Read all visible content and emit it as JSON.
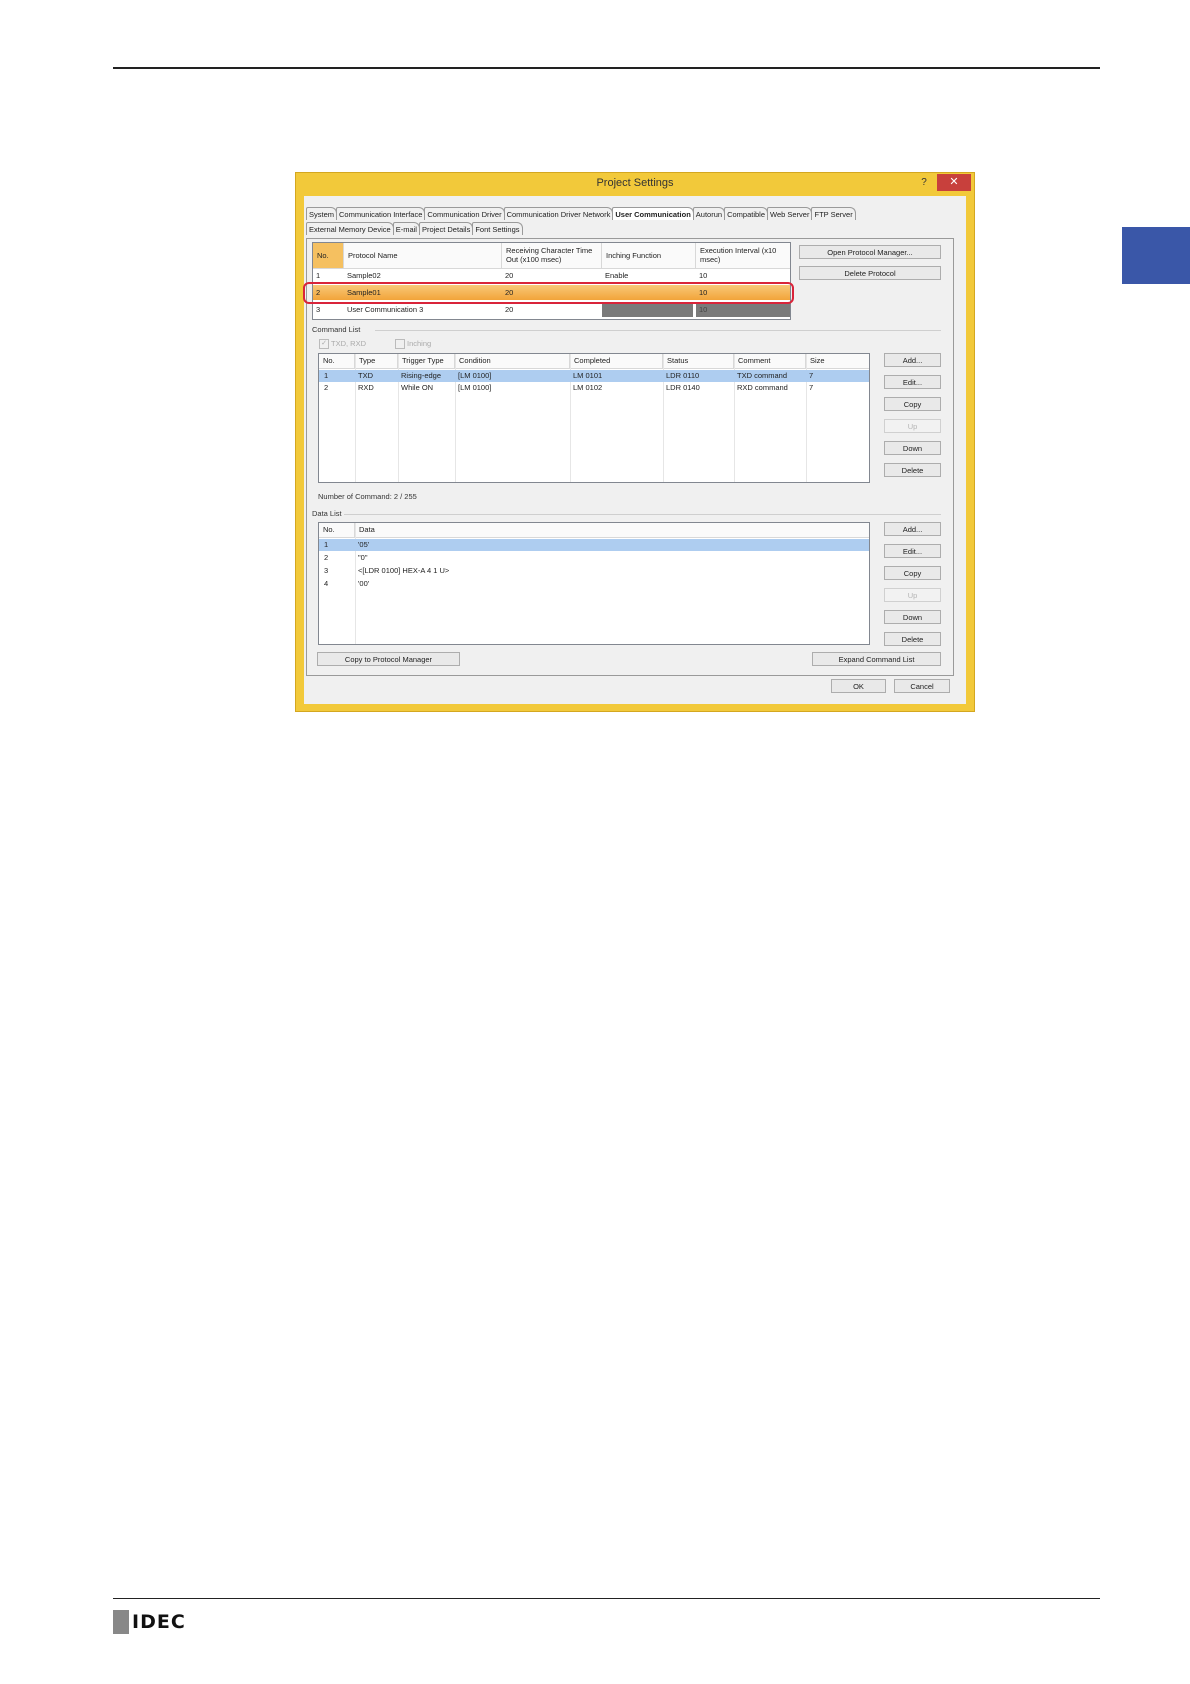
{
  "dialog": {
    "title": "Project Settings",
    "help": "?",
    "close": "✕",
    "tabs_row1": [
      "System",
      "Communication Interface",
      "Communication Driver",
      "Communication Driver Network",
      "User Communication",
      "Autorun",
      "Compatible",
      "Web Server",
      "FTP Server"
    ],
    "tabs_row2": [
      "External Memory Device",
      "E-mail",
      "Project Details",
      "Font Settings"
    ],
    "active_tab": "User Communication"
  },
  "protocols": {
    "headers": {
      "no": "No.",
      "name": "Protocol Name",
      "timeout": "Receiving Character Time Out (x100 msec)",
      "inching": "Inching Function",
      "interval": "Execution Interval (x10 msec)"
    },
    "rows": [
      {
        "no": "1",
        "name": "Sample02",
        "timeout": "20",
        "inching": "Enable",
        "interval": "10"
      },
      {
        "no": "2",
        "name": "Sample01",
        "timeout": "20",
        "inching": "",
        "interval": "10"
      },
      {
        "no": "3",
        "name": "User Communication 3",
        "timeout": "20",
        "inching": "",
        "interval": "10"
      }
    ],
    "open_manager": "Open Protocol Manager...",
    "delete_protocol": "Delete Protocol"
  },
  "command_list": {
    "group": "Command List",
    "txd_rxd": "TXD, RXD",
    "inching": "Inching",
    "headers": {
      "no": "No.",
      "type": "Type",
      "trigger": "Trigger Type",
      "condition": "Condition",
      "completed": "Completed",
      "status": "Status",
      "comment": "Comment",
      "size": "Size"
    },
    "rows": [
      {
        "no": "1",
        "type": "TXD",
        "trigger": "Rising-edge",
        "condition": "[LM 0100]",
        "completed": "LM 0101",
        "status": "LDR 0110",
        "comment": "TXD command",
        "size": "7"
      },
      {
        "no": "2",
        "type": "RXD",
        "trigger": "While ON",
        "condition": "[LM 0100]",
        "completed": "LM 0102",
        "status": "LDR 0140",
        "comment": "RXD command",
        "size": "7"
      }
    ],
    "buttons": {
      "add": "Add...",
      "edit": "Edit...",
      "copy": "Copy",
      "up": "Up",
      "down": "Down",
      "delete": "Delete"
    },
    "count": "Number of Command: 2 / 255"
  },
  "data_list": {
    "group": "Data List",
    "headers": {
      "no": "No.",
      "data": "Data"
    },
    "rows": [
      {
        "no": "1",
        "data": "'05'"
      },
      {
        "no": "2",
        "data": "\"0\""
      },
      {
        "no": "3",
        "data": "<[LDR 0100] HEX-A 4 1 U>"
      },
      {
        "no": "4",
        "data": "'00'"
      }
    ],
    "buttons": {
      "add": "Add...",
      "edit": "Edit...",
      "copy": "Copy",
      "up": "Up",
      "down": "Down",
      "delete": "Delete"
    }
  },
  "footer_buttons": {
    "copy_to_manager": "Copy to Protocol Manager",
    "expand": "Expand Command List",
    "ok": "OK",
    "cancel": "Cancel"
  },
  "page": {
    "logo": "IDEC"
  },
  "colors": {
    "dialog_frame": "#f2c93a",
    "close": "#c8403c",
    "selection": "#f5b04a",
    "row_select": "#aecdf0",
    "highlight_ring": "#d9243a",
    "side_tab": "#3a57a8"
  }
}
